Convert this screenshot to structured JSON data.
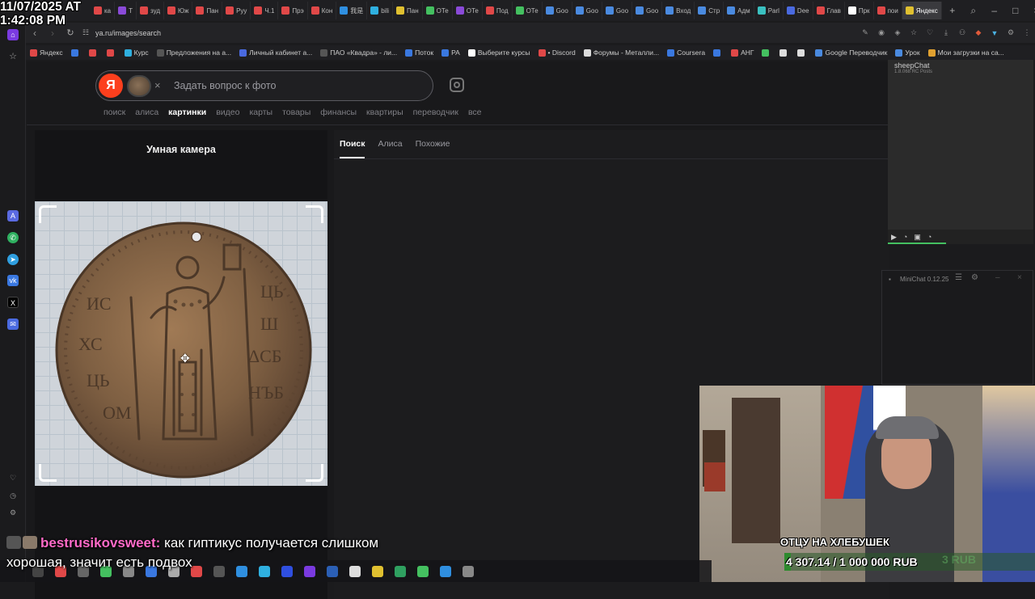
{
  "overlay": {
    "timestamp_line1": "11/07/2025 AT",
    "timestamp_line2": "1:42:08 PM",
    "chat_user": "bestrusikovsweet:",
    "chat_message_1": " как гиптикус получается слишком",
    "chat_message_2": "хорошая, значит есть подвох",
    "webcam_caption": "ОТЦУ НА ХЛЕБУШЕК",
    "donation_goal": "4 307.14 / 1 000 000 RUB",
    "donation_ghost": "3 RUB"
  },
  "browser": {
    "tabs": [
      {
        "label": "ка",
        "color": "#e04848"
      },
      {
        "label": "Т",
        "color": "#8a4ad8"
      },
      {
        "label": "зуд",
        "color": "#e04848"
      },
      {
        "label": "Юж",
        "color": "#e04848"
      },
      {
        "label": "Пан",
        "color": "#e04848"
      },
      {
        "label": "Руу",
        "color": "#e04848"
      },
      {
        "label": "Ч.1",
        "color": "#e04848"
      },
      {
        "label": "Прэ",
        "color": "#e04848"
      },
      {
        "label": "Кон",
        "color": "#e04848"
      },
      {
        "label": "我是",
        "color": "#2f8fe0"
      },
      {
        "label": "bili",
        "color": "#2fb0e0"
      },
      {
        "label": "Пан",
        "color": "#e0c030"
      },
      {
        "label": "ОТе",
        "color": "#44c060"
      },
      {
        "label": "ОТе",
        "color": "#8a4ad8"
      },
      {
        "label": "Под",
        "color": "#e04848"
      },
      {
        "label": "ОТе",
        "color": "#44c060"
      },
      {
        "label": "Goo",
        "color": "#4a8ae0"
      },
      {
        "label": "Goo",
        "color": "#4a8ae0"
      },
      {
        "label": "Goo",
        "color": "#4a8ae0"
      },
      {
        "label": "Goo",
        "color": "#4a8ae0"
      },
      {
        "label": "Вход",
        "color": "#4a8ae0"
      },
      {
        "label": "Стр",
        "color": "#4a8ae0"
      },
      {
        "label": "Адм",
        "color": "#4a8ae0"
      },
      {
        "label": "Parl",
        "color": "#3ac0c0"
      },
      {
        "label": "Dee",
        "color": "#4a6ae0"
      },
      {
        "label": "Глав",
        "color": "#e04848"
      },
      {
        "label": "Прк",
        "color": "#ffffff"
      },
      {
        "label": "пои",
        "color": "#e04848"
      },
      {
        "label": "Яндекс",
        "color": "#e0c030"
      }
    ],
    "url": "ya.ru/images/search",
    "bookmarks": [
      {
        "label": "Яндекс",
        "color": "#e04848"
      },
      {
        "label": "",
        "color": "#3a78e0"
      },
      {
        "label": "",
        "color": "#e04848"
      },
      {
        "label": "",
        "color": "#e04848"
      },
      {
        "label": "Курс",
        "color": "#2fb0e0"
      },
      {
        "label": "Предложения на а...",
        "color": "#555"
      },
      {
        "label": "Личный кабинет а...",
        "color": "#4a6ae0"
      },
      {
        "label": "ПАО «Квадра» - ли...",
        "color": "#555"
      },
      {
        "label": "Поток",
        "color": "#3a78e0"
      },
      {
        "label": "РА",
        "color": "#3a78e0"
      },
      {
        "label": "Выберите курсы",
        "color": "#ffffff"
      },
      {
        "label": "• Discord",
        "color": "#e04848"
      },
      {
        "label": "Форумы - Металли...",
        "color": "#ddd"
      },
      {
        "label": "Coursera",
        "color": "#3a78e0"
      },
      {
        "label": "",
        "color": "#3a78e0"
      },
      {
        "label": "АНГ",
        "color": "#e04848"
      },
      {
        "label": "",
        "color": "#44c060"
      },
      {
        "label": "",
        "color": "#ddd"
      },
      {
        "label": "",
        "color": "#ddd"
      },
      {
        "label": "Google Переводчик",
        "color": "#4a8ae0"
      },
      {
        "label": "Урок",
        "color": "#4a8ae0"
      },
      {
        "label": "Мои загрузки на са...",
        "color": "#e0a030"
      }
    ]
  },
  "yandex": {
    "logo_letter": "Я",
    "search_placeholder": "Задать вопрос к фото",
    "nav": [
      "поиск",
      "алиса",
      "картинки",
      "видео",
      "карты",
      "товары",
      "финансы",
      "квартиры",
      "переводчик",
      "все"
    ],
    "nav_active_index": 2,
    "smart_camera_title": "Умная камера",
    "result_tabs": [
      "Поиск",
      "Алиса",
      "Похожие"
    ],
    "coin_inscriptions": [
      "ИС",
      "ХС",
      "ЦЬ",
      "Ш",
      "ΔСБ",
      "НЪБ",
      "ОМ",
      "ЦЬ"
    ]
  },
  "widgets": {
    "sheepchat_title": "sheepChat",
    "sheepchat_sub": "1.8.068 RC Posts",
    "minichat_title": "MiniChat 0.12.25"
  }
}
